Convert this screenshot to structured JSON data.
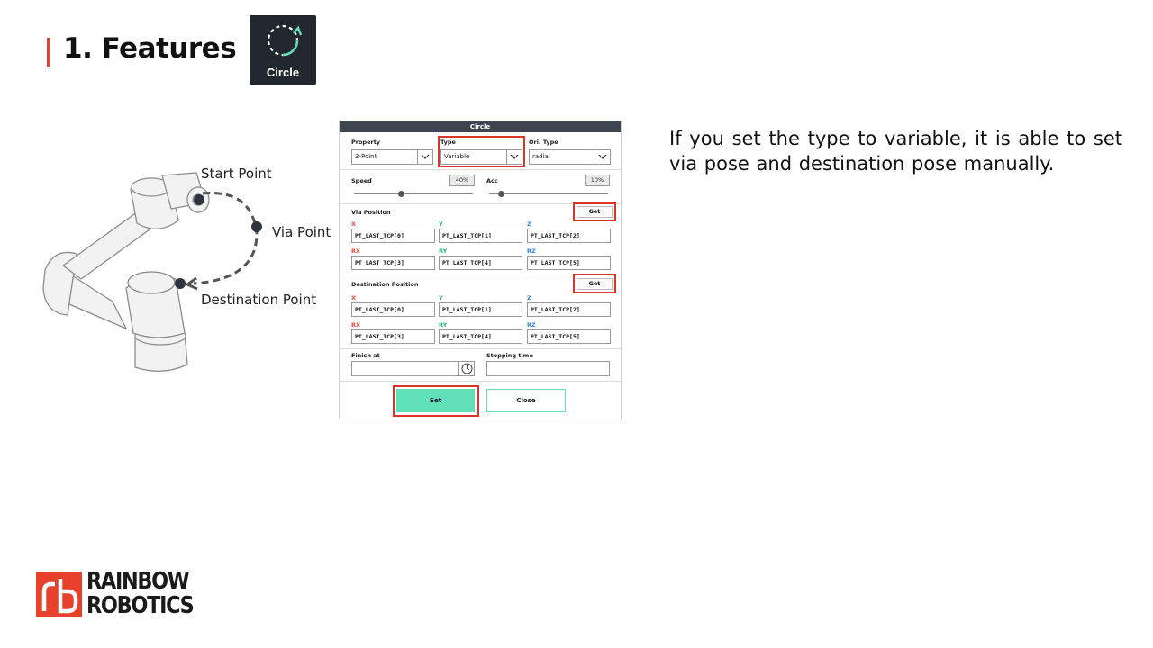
{
  "slide": {
    "title": "1. Features",
    "accent_color": "#e8412b"
  },
  "circle_tile": {
    "label": "Circle",
    "icon": "circle-arrow-icon"
  },
  "illustration": {
    "start_point": "Start Point",
    "via_point": "Via Point",
    "destination_point": "Destination Point"
  },
  "dialog": {
    "title": "Circle",
    "property": {
      "label": "Property",
      "value": "3-Point"
    },
    "type": {
      "label": "Type",
      "value": "Variable"
    },
    "ori_type": {
      "label": "Ori. Type",
      "value": "radial"
    },
    "speed": {
      "label": "Speed",
      "value": "40%",
      "level": 0.4
    },
    "acc": {
      "label": "Acc",
      "value": "10%",
      "level": 0.1
    },
    "via_position": {
      "label": "Via Position",
      "get_label": "Get",
      "axes": [
        "X",
        "Y",
        "Z",
        "RX",
        "RY",
        "RZ"
      ],
      "values": [
        "PT_LAST_TCP[0]",
        "PT_LAST_TCP[1]",
        "PT_LAST_TCP[2]",
        "PT_LAST_TCP[3]",
        "PT_LAST_TCP[4]",
        "PT_LAST_TCP[5]"
      ]
    },
    "destination_position": {
      "label": "Destination Position",
      "get_label": "Get",
      "axes": [
        "X",
        "Y",
        "Z",
        "RX",
        "RY",
        "RZ"
      ],
      "values": [
        "PT_LAST_TCP[0]",
        "PT_LAST_TCP[1]",
        "PT_LAST_TCP[2]",
        "PT_LAST_TCP[3]",
        "PT_LAST_TCP[4]",
        "PT_LAST_TCP[5]"
      ]
    },
    "finish_at": {
      "label": "Finish at",
      "value": ""
    },
    "stopping_time": {
      "label": "Stopping time",
      "value": ""
    },
    "set_label": "Set",
    "close_label": "Close",
    "highlight_color": "#d9352b",
    "primary_color": "#5fe0b7"
  },
  "description": "If you set the type to variable, it is able to set via pose and destination pose manually.",
  "logo": {
    "line1": "RAINBOW",
    "line2": "ROBOTICS",
    "color": "#e8412b"
  }
}
